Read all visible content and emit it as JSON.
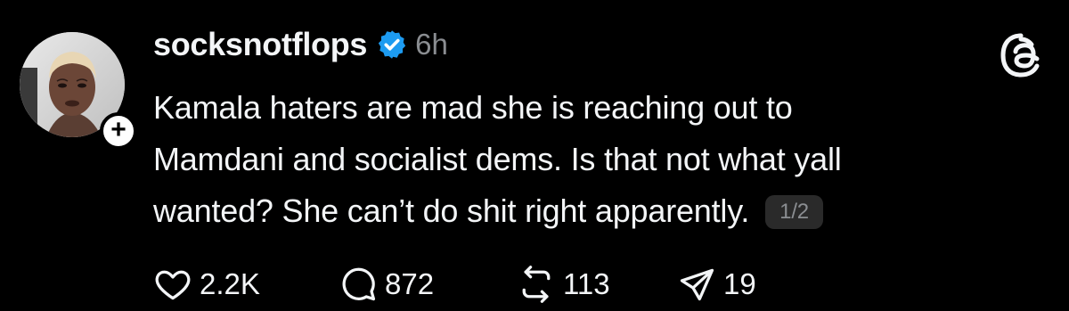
{
  "post": {
    "username": "socksnotflops",
    "timestamp": "6h",
    "verified": true,
    "body_lines": [
      "Kamala haters are mad she is reaching out to",
      "Mamdani and socialist dems. Is that not what yall",
      "wanted? She can’t do shit right apparently."
    ],
    "page_indicator": "1/2",
    "actions": {
      "likes": "2.2K",
      "replies": "872",
      "reposts": "113",
      "shares": "19"
    }
  },
  "icons": {
    "verified": "verified-badge-icon",
    "logo": "threads-logo-icon",
    "like": "heart-icon",
    "reply": "speech-bubble-icon",
    "repost": "repost-icon",
    "share": "send-icon",
    "follow": "plus-icon"
  },
  "colors": {
    "background": "#000000",
    "text": "#f3f5f7",
    "muted": "#8a8d91",
    "verified": "#1d9bf0",
    "badge_bg": "#2a2a2a"
  },
  "follow_badge_label": "+"
}
